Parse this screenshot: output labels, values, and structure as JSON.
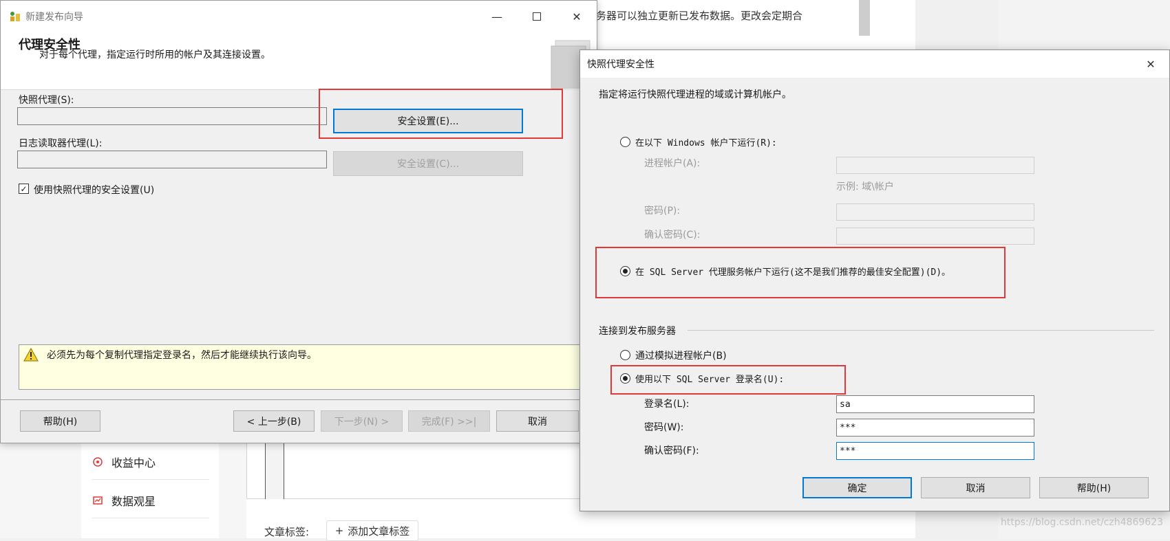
{
  "background": {
    "side_items": [
      {
        "label": "收益中心",
        "icon": "coin-icon"
      },
      {
        "label": "数据观星",
        "icon": "chart-icon"
      }
    ],
    "top_text": "务器可以独立更新已发布数据。更改会定期合",
    "tag_label": "文章标签:",
    "tag_button": "添加文章标签",
    "watermark": "https://blog.csdn.net/czh4869623"
  },
  "wizard": {
    "title": "新建发布向导",
    "header_title": "代理安全性",
    "header_subtitle": "对于每个代理，指定运行时所用的帐户及其连接设置。",
    "snapshot_label": "快照代理(S):",
    "snapshot_value": "",
    "snapshot_button": "安全设置(E)...",
    "logreader_label": "日志读取器代理(L):",
    "logreader_value": "",
    "logreader_button": "安全设置(C)...",
    "use_snapshot_checkbox": "使用快照代理的安全设置(U)",
    "warning": "必须先为每个复制代理指定登录名，然后才能继续执行该向导。",
    "buttons": {
      "help": "帮助(H)",
      "back": "< 上一步(B)",
      "next": "下一步(N) >",
      "finish": "完成(F) >>|",
      "cancel": "取消"
    }
  },
  "dialog": {
    "title": "快照代理安全性",
    "description": "指定将运行快照代理进程的域或计算机帐户。",
    "windows_radio": "在以下 Windows 帐户下运行(R):",
    "process_account_label": "进程帐户(A):",
    "example_text": "示例: 域\\帐户",
    "password_label": "密码(P):",
    "confirm_password_label": "确认密码(C):",
    "sql_agent_radio": "在 SQL Server 代理服务帐户下运行(这不是我们推荐的最佳安全配置)(D)。",
    "connect_group": "连接到发布服务器",
    "impersonate_radio": "通过模拟进程帐户(B)",
    "sql_login_radio": "使用以下 SQL Server 登录名(U):",
    "login_label": "登录名(L):",
    "login_value": "sa",
    "password2_label": "密码(W):",
    "password2_value": "***",
    "confirm2_label": "确认密码(F):",
    "confirm2_value": "***",
    "buttons": {
      "ok": "确定",
      "cancel": "取消",
      "help": "帮助(H)"
    }
  },
  "colors": {
    "highlight": "#e33838",
    "focus": "#0078d7",
    "warning_bg": "#ffffe1"
  }
}
